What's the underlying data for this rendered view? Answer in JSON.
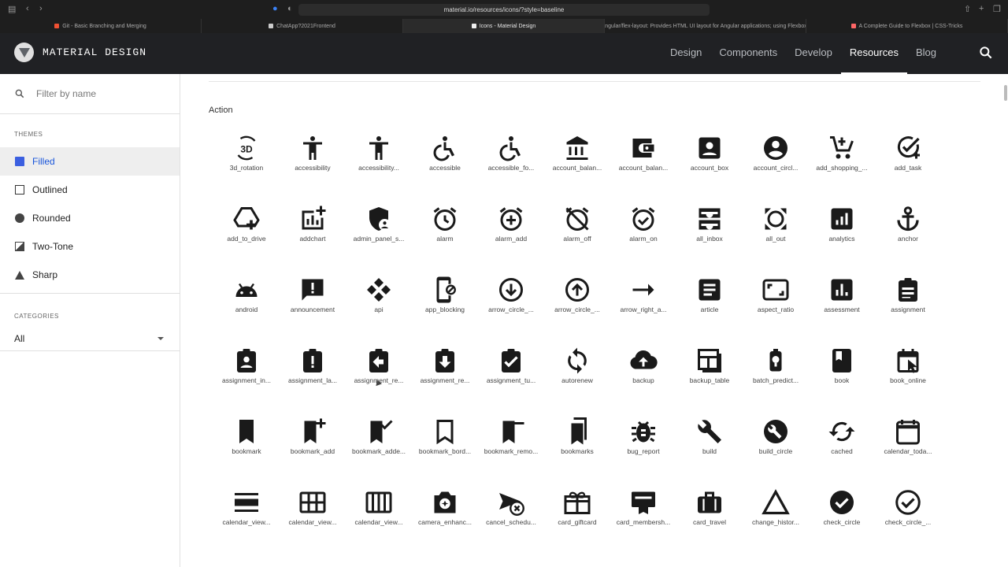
{
  "browser": {
    "url": "material.io/resources/icons/?style=baseline",
    "tabs": [
      {
        "label": "Git - Basic Branching and Merging",
        "fav_color": "#f05133"
      },
      {
        "label": "ChatApp?2021Frontend",
        "fav_color": "#cccccc"
      },
      {
        "label": "Icons - Material Design",
        "fav_color": "#eeeeee"
      },
      {
        "label": "angular/flex-layout: Provides HTML UI layout for Angular applications; using Flexbox...",
        "fav_color": "#dddddd"
      },
      {
        "label": "A Complete Guide to Flexbox | CSS-Tricks",
        "fav_color": "#ff6666"
      }
    ]
  },
  "app": {
    "brand": "MATERIAL DESIGN",
    "nav": [
      "Design",
      "Components",
      "Develop",
      "Resources",
      "Blog"
    ]
  },
  "sidebar": {
    "filter_placeholder": "Filter by name",
    "themes_label": "THEMES",
    "themes": [
      {
        "label": "Filled",
        "shape": "filled-square",
        "color": "#3b5fe0"
      },
      {
        "label": "Outlined",
        "shape": "outline-square",
        "color": "#333333"
      },
      {
        "label": "Rounded",
        "shape": "circle",
        "color": "#444444"
      },
      {
        "label": "Two-Tone",
        "shape": "two-tone",
        "color": "#444444"
      },
      {
        "label": "Sharp",
        "shape": "triangle",
        "color": "#444444"
      }
    ],
    "categories_label": "CATEGORIES",
    "category_value": "All"
  },
  "main": {
    "section_title": "Action",
    "icons": [
      {
        "label": "3d_rotation",
        "icon": "3d"
      },
      {
        "label": "accessibility",
        "icon": "person"
      },
      {
        "label": "accessibility...",
        "icon": "person"
      },
      {
        "label": "accessible",
        "icon": "wheelchair"
      },
      {
        "label": "accessible_fo...",
        "icon": "wheelchair"
      },
      {
        "label": "account_balan...",
        "icon": "bank"
      },
      {
        "label": "account_balan...",
        "icon": "wallet"
      },
      {
        "label": "account_box",
        "icon": "userbox"
      },
      {
        "label": "account_circl...",
        "icon": "usercircle"
      },
      {
        "label": "add_shopping_...",
        "icon": "cart"
      },
      {
        "label": "add_task",
        "icon": "checkplus"
      },
      {
        "label": "add_to_drive",
        "icon": "drive"
      },
      {
        "label": "addchart",
        "icon": "chartplus"
      },
      {
        "label": "admin_panel_s...",
        "icon": "shield"
      },
      {
        "label": "alarm",
        "icon": "alarm"
      },
      {
        "label": "alarm_add",
        "icon": "alarmplus"
      },
      {
        "label": "alarm_off",
        "icon": "alarmoff"
      },
      {
        "label": "alarm_on",
        "icon": "alarmcheck"
      },
      {
        "label": "all_inbox",
        "icon": "inbox"
      },
      {
        "label": "all_out",
        "icon": "allout"
      },
      {
        "label": "analytics",
        "icon": "analytics"
      },
      {
        "label": "anchor",
        "icon": "anchor"
      },
      {
        "label": "android",
        "icon": "android"
      },
      {
        "label": "announcement",
        "icon": "announce"
      },
      {
        "label": "api",
        "icon": "api"
      },
      {
        "label": "app_blocking",
        "icon": "phoneblock"
      },
      {
        "label": "arrow_circle_...",
        "icon": "arrowdown"
      },
      {
        "label": "arrow_circle_...",
        "icon": "arrowup"
      },
      {
        "label": "arrow_right_a...",
        "icon": "arrowright"
      },
      {
        "label": "article",
        "icon": "article"
      },
      {
        "label": "aspect_ratio",
        "icon": "aspect"
      },
      {
        "label": "assessment",
        "icon": "assessment"
      },
      {
        "label": "assignment",
        "icon": "assignment"
      },
      {
        "label": "assignment_in...",
        "icon": "clipperson"
      },
      {
        "label": "assignment_la...",
        "icon": "clipexcl"
      },
      {
        "label": "assignment_re...",
        "icon": "clipleft"
      },
      {
        "label": "assignment_re...",
        "icon": "clipdown"
      },
      {
        "label": "assignment_tu...",
        "icon": "clipcheck"
      },
      {
        "label": "autorenew",
        "icon": "renew"
      },
      {
        "label": "backup",
        "icon": "cloudup"
      },
      {
        "label": "backup_table",
        "icon": "table"
      },
      {
        "label": "batch_predict...",
        "icon": "bulb"
      },
      {
        "label": "book",
        "icon": "book"
      },
      {
        "label": "book_online",
        "icon": "calcursor"
      },
      {
        "label": "bookmark",
        "icon": "bookmark"
      },
      {
        "label": "bookmark_add",
        "icon": "bookmarkplus"
      },
      {
        "label": "bookmark_adde...",
        "icon": "bookmarkcheck"
      },
      {
        "label": "bookmark_bord...",
        "icon": "bookmarkborder"
      },
      {
        "label": "bookmark_remo...",
        "icon": "bookmarkminus"
      },
      {
        "label": "bookmarks",
        "icon": "bookmarks"
      },
      {
        "label": "bug_report",
        "icon": "bug"
      },
      {
        "label": "build",
        "icon": "wrench"
      },
      {
        "label": "build_circle",
        "icon": "wrenchcircle"
      },
      {
        "label": "cached",
        "icon": "cached"
      },
      {
        "label": "calendar_toda...",
        "icon": "calendar"
      },
      {
        "label": "calendar_view...",
        "icon": "viewday"
      },
      {
        "label": "calendar_view...",
        "icon": "viewmonth"
      },
      {
        "label": "calendar_view...",
        "icon": "viewweek"
      },
      {
        "label": "camera_enhanc...",
        "icon": "camera"
      },
      {
        "label": "cancel_schedu...",
        "icon": "cancelsend"
      },
      {
        "label": "card_giftcard",
        "icon": "gift"
      },
      {
        "label": "card_membersh...",
        "icon": "membership"
      },
      {
        "label": "card_travel",
        "icon": "suitcase"
      },
      {
        "label": "change_histor...",
        "icon": "triangle"
      },
      {
        "label": "check_circle",
        "icon": "checkcircle"
      },
      {
        "label": "check_circle_...",
        "icon": "checkcircleoutline"
      }
    ]
  }
}
